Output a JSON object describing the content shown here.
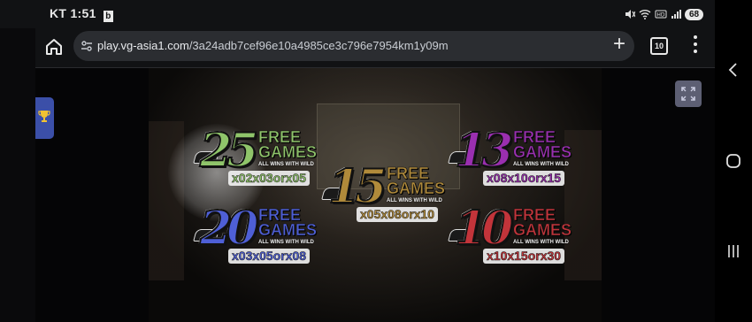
{
  "status_bar": {
    "carrier": "KT",
    "time": "1:51",
    "battery": "68"
  },
  "browser": {
    "url_host": "play.vg-asia1.com",
    "url_path": "/3a24adb7cef96e10a4985ce3c796e7954km1y09m",
    "tab_count": "10"
  },
  "game": {
    "badges": [
      {
        "number": "25",
        "label_line1": "FREE",
        "label_line2": "GAMES",
        "wild_text": "ALL WINS WITH WILD",
        "multipliers": "x02x03orx05",
        "color": "#8fc46a"
      },
      {
        "number": "20",
        "label_line1": "FREE",
        "label_line2": "GAMES",
        "wild_text": "ALL WINS WITH WILD",
        "multipliers": "x03x05orx08",
        "color": "#4e5fd6"
      },
      {
        "number": "15",
        "label_line1": "FREE",
        "label_line2": "GAMES",
        "wild_text": "ALL WINS WITH WILD",
        "multipliers": "x05x08orx10",
        "color": "#b08a3a"
      },
      {
        "number": "13",
        "label_line1": "FREE",
        "label_line2": "GAMES",
        "wild_text": "ALL WINS WITH WILD",
        "multipliers": "x08x10orx15",
        "color": "#9a2fb0"
      },
      {
        "number": "10",
        "label_line1": "FREE",
        "label_line2": "GAMES",
        "wild_text": "ALL WINS WITH WILD",
        "multipliers": "x10x15orx30",
        "color": "#c2343a"
      }
    ]
  },
  "icons": {
    "home": "home-icon",
    "site_settings": "tune-icon",
    "new_tab": "plus-icon",
    "tabs": "tab-switcher-icon",
    "menu": "more-vert-icon",
    "trophy": "trophy-icon",
    "fullscreen": "fullscreen-icon",
    "back": "back-icon",
    "home_nav": "circle-home-icon",
    "recents": "recents-icon"
  }
}
